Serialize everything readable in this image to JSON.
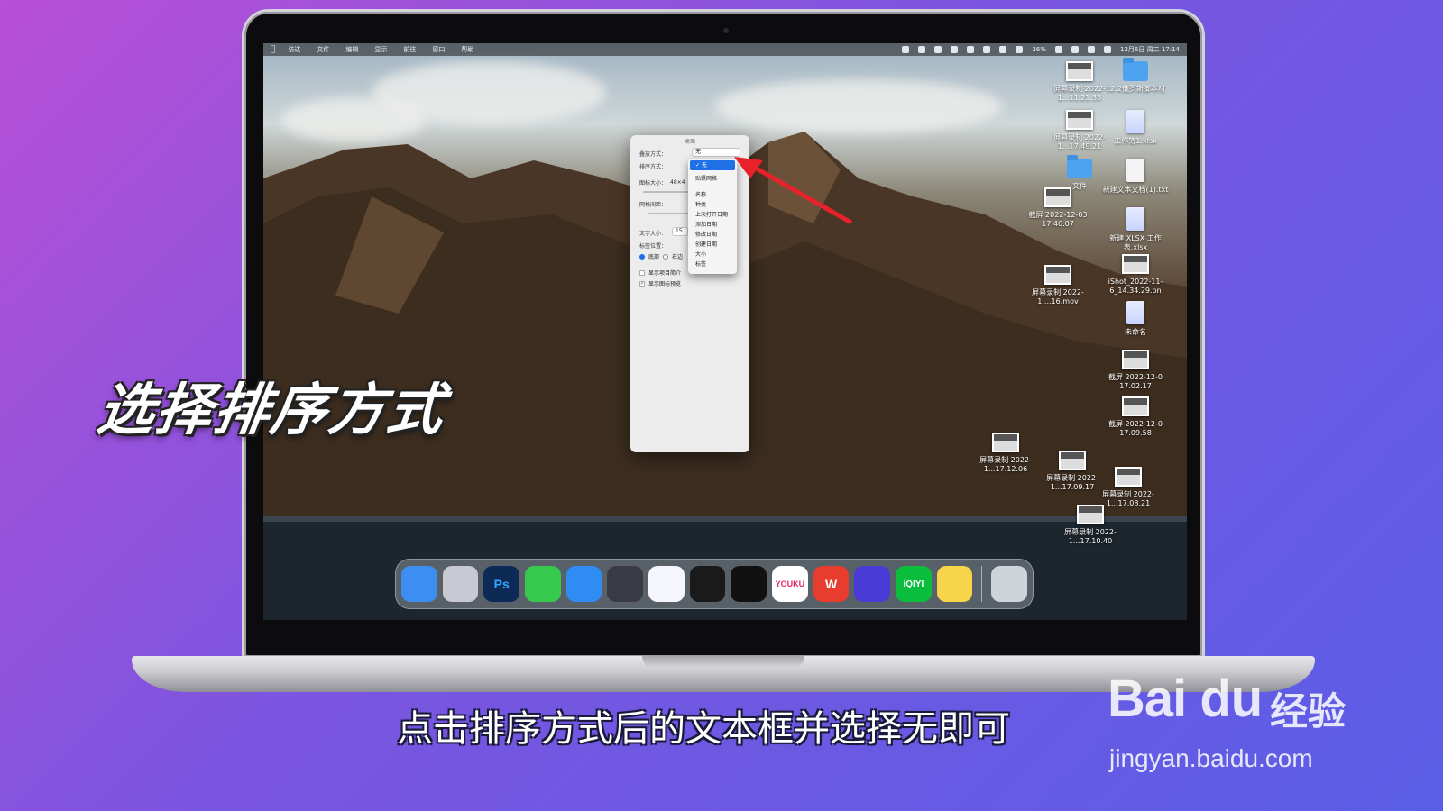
{
  "overlay": {
    "title": "选择排序方式",
    "subtitle": "点击排序方式后的文本框并选择无即可"
  },
  "watermark": {
    "logo": "Bai du",
    "cn": "经验",
    "url": "jingyan.baidu.com"
  },
  "menubar": {
    "apple": "",
    "items": [
      "访达",
      "文件",
      "编辑",
      "显示",
      "前往",
      "窗口",
      "帮助"
    ],
    "battery": "36%",
    "datetime": "12月6日 周二 17:14"
  },
  "panel": {
    "title": "桌面",
    "stack_label": "叠放方式：",
    "stack_value": "无",
    "sort_label": "排序方式：",
    "icon_size_label": "图标大小：",
    "icon_size_value": "48×4",
    "grid_spacing_label": "网格间距：",
    "text_size_label": "文字大小：",
    "text_size_value": "15",
    "label_pos_label": "标签位置：",
    "label_bottom": "底部",
    "label_right": "右边",
    "show_info_label": "显示项目简介",
    "show_preview_label": "显示图标预览"
  },
  "dropdown": {
    "selected": "无",
    "snap": "贴紧网格",
    "options": [
      "名称",
      "种类",
      "上次打开日期",
      "添加日期",
      "修改日期",
      "创建日期",
      "大小",
      "标签"
    ]
  },
  "desktop_icons": [
    {
      "label": "屏幕录制 2022-1...11.21.33"
    },
    {
      "label": "12.2俄罗斯脚本材"
    },
    {
      "label": "屏幕录制 2022-1...17.49.21"
    },
    {
      "label": "工作簿1.xlsx"
    },
    {
      "label": "文件"
    },
    {
      "label": "新建文本文档(1).txt"
    },
    {
      "label": "截屏 2022-12-03 17.46.07"
    },
    {
      "label": "新建 XLSX 工作表.xlsx"
    },
    {
      "label": "屏幕录制 2022-1....16.mov"
    },
    {
      "label": "iShot_2022-11-6_14.34.29.pn"
    },
    {
      "label": "未命名"
    },
    {
      "label": "截屏 2022-12-0 17.02.17"
    },
    {
      "label": "截屏 2022-12-0 17.09.58"
    },
    {
      "label": "屏幕录制 2022-1...17.12.06"
    },
    {
      "label": "屏幕录制 2022-1...17.09.17"
    },
    {
      "label": "屏幕录制 2022-1...17.08.21"
    },
    {
      "label": "屏幕录制 2022-1...17.10.40"
    }
  ],
  "dock": {
    "apps": [
      {
        "name": "finder",
        "label": "",
        "color": "#3d8ef0"
      },
      {
        "name": "launchpad",
        "label": "",
        "color": "#c9c9d3"
      },
      {
        "name": "photoshop",
        "label": "Ps",
        "color": "#0c2a55"
      },
      {
        "name": "messages",
        "label": "",
        "color": "#37c94d"
      },
      {
        "name": "safari",
        "label": "",
        "color": "#2f8cf2"
      },
      {
        "name": "quicktime",
        "label": "",
        "color": "#3a3a44"
      },
      {
        "name": "feishu",
        "label": "",
        "color": "#f4f6fb"
      },
      {
        "name": "qq",
        "label": "",
        "color": "#1a1a1a"
      },
      {
        "name": "video-app",
        "label": "",
        "color": "#111"
      },
      {
        "name": "youku",
        "label": "YOUKU",
        "color": "#ffffff"
      },
      {
        "name": "wps",
        "label": "W",
        "color": "#e83c2e"
      },
      {
        "name": "shortcuts",
        "label": "",
        "color": "#4a3ad6"
      },
      {
        "name": "iqiyi",
        "label": "iQIYI",
        "color": "#0bbd3c"
      },
      {
        "name": "notes",
        "label": "",
        "color": "#f8d44a"
      },
      {
        "name": "trash",
        "label": "",
        "color": "#cfd3da"
      }
    ]
  }
}
